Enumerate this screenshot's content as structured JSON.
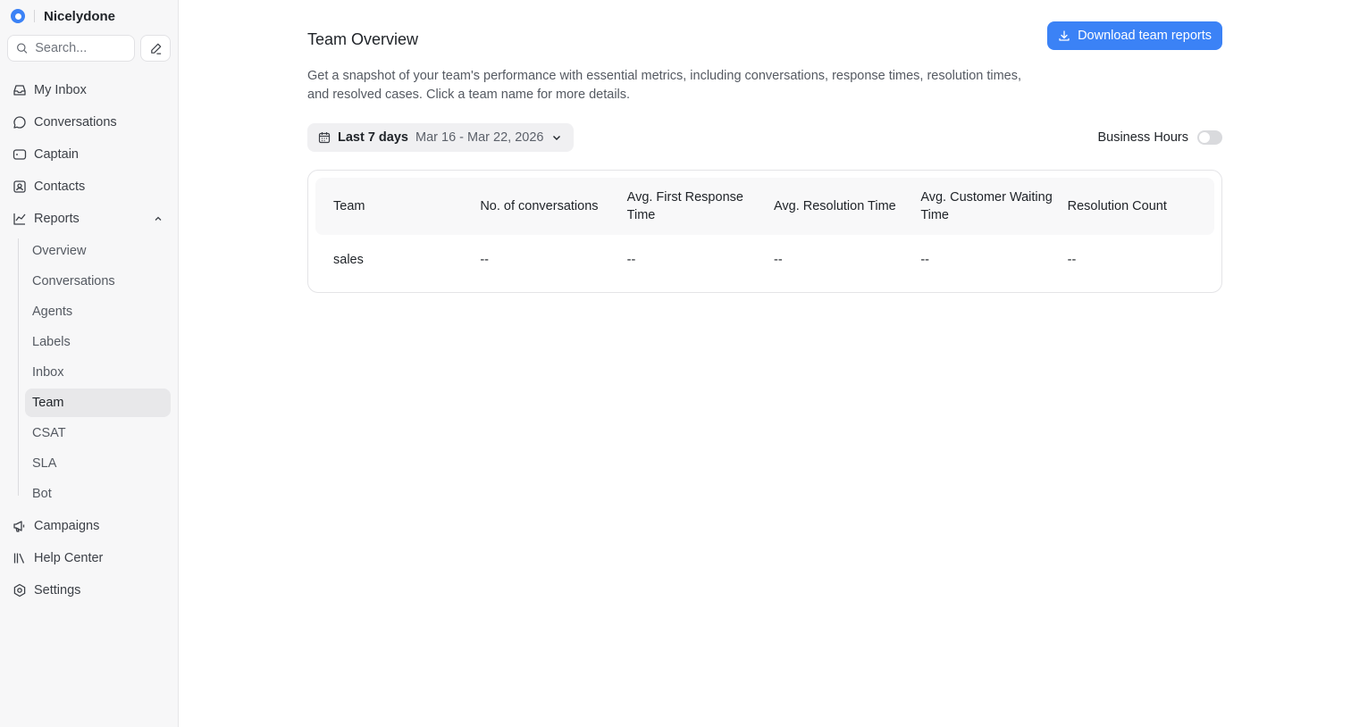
{
  "brand": {
    "name": "Nicelydone"
  },
  "search": {
    "placeholder": "Search..."
  },
  "nav": {
    "items": [
      {
        "label": "My Inbox",
        "icon": "inbox-icon"
      },
      {
        "label": "Conversations",
        "icon": "chat-bubble-icon"
      },
      {
        "label": "Captain",
        "icon": "captain-icon"
      },
      {
        "label": "Contacts",
        "icon": "contacts-icon"
      },
      {
        "label": "Reports",
        "icon": "chart-line-icon"
      }
    ],
    "reports_sub": [
      "Overview",
      "Conversations",
      "Agents",
      "Labels",
      "Inbox",
      "Team",
      "CSAT",
      "SLA",
      "Bot"
    ],
    "bottom_items": [
      {
        "label": "Campaigns",
        "icon": "megaphone-icon"
      },
      {
        "label": "Help Center",
        "icon": "library-icon"
      },
      {
        "label": "Settings",
        "icon": "settings-icon"
      }
    ],
    "active_sub": "Team"
  },
  "page": {
    "title": "Team Overview",
    "download_label": "Download team reports",
    "description": "Get a snapshot of your team's performance with essential metrics, including conversations, response times, resolution times, and resolved cases. Click a team name for more details."
  },
  "filters": {
    "date_range_label": "Last 7 days",
    "date_range_value": "Mar 16 - Mar 22, 2026",
    "business_hours_label": "Business Hours",
    "business_hours_on": false
  },
  "table": {
    "headers": [
      "Team",
      "No. of conversations",
      "Avg. First Response Time",
      "Avg. Resolution Time",
      "Avg. Customer Waiting Time",
      "Resolution Count"
    ],
    "rows": [
      [
        "sales",
        "--",
        "--",
        "--",
        "--",
        "--"
      ]
    ]
  },
  "colors": {
    "accent": "#3b82f6",
    "sidebar_bg": "#f7f7f8",
    "active_bg": "#e8e8ea"
  }
}
